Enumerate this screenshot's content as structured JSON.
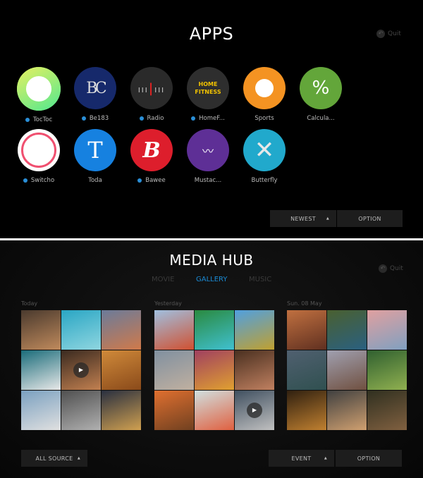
{
  "apps": {
    "title": "APPS",
    "quit": "Quit",
    "items": [
      {
        "label": "TocToc",
        "checked": true,
        "icon": "speech-bubble-icon",
        "color": "#7ee06a"
      },
      {
        "label": "Be183",
        "checked": true,
        "icon": "bc-logo-icon",
        "color": "#16296b"
      },
      {
        "label": "Radio",
        "checked": true,
        "icon": "radio-tuner-icon",
        "color": "#2a2a2a"
      },
      {
        "label": "HomeF...",
        "checked": true,
        "icon": "home-fitness-icon",
        "color": "#2e2e2e",
        "icon_text": "HOME FITNESS"
      },
      {
        "label": "Sports",
        "checked": false,
        "icon": "baseball-icon",
        "color": "#f49322"
      },
      {
        "label": "Calcula...",
        "checked": false,
        "icon": "percent-icon",
        "color": "#63a63a"
      },
      {
        "label": "Switcho",
        "checked": true,
        "icon": "power-dial-icon",
        "color": "#ffffff"
      },
      {
        "label": "Toda",
        "checked": false,
        "icon": "letter-t-icon",
        "color": "#1681e0",
        "icon_text": "T"
      },
      {
        "label": "Bawee",
        "checked": true,
        "icon": "letter-b-icon",
        "color": "#dd1e2c",
        "icon_text": "B"
      },
      {
        "label": "Mustac...",
        "checked": false,
        "icon": "mustache-wave-icon",
        "color": "#5e2f96"
      },
      {
        "label": "Butterfly",
        "checked": false,
        "icon": "butterfly-x-icon",
        "color": "#21a9cc"
      }
    ],
    "sort_button": "NEWEST",
    "option_button": "OPTION"
  },
  "media": {
    "title": "MEDIA HUB",
    "quit": "Quit",
    "tabs": [
      {
        "label": "MOVIE",
        "active": false
      },
      {
        "label": "GALLERY",
        "active": true
      },
      {
        "label": "MUSIC",
        "active": false
      }
    ],
    "groups": [
      {
        "label": "Today",
        "tiles": [
          [
            "#4a3a2e",
            "#c08a5c",
            false
          ],
          [
            "#2aa6c4",
            "#8fd6e0",
            false
          ],
          [
            "#6b7b9a",
            "#d07a4a",
            false
          ],
          [
            "#1a6c7a",
            "#e8e8e8",
            false
          ],
          [
            "#3a2a20",
            "#c28050",
            true
          ],
          [
            "#d08a3a",
            "#8a4a1a",
            false
          ],
          [
            "#7aa0c0",
            "#e0e0e0",
            false
          ],
          [
            "#505050",
            "#b0b0b0",
            false
          ],
          [
            "#2a3040",
            "#d0a050",
            false
          ]
        ]
      },
      {
        "label": "Yesterday",
        "tiles": [
          [
            "#a0c0e0",
            "#d05030",
            false
          ],
          [
            "#2a8a40",
            "#40c0d0",
            false
          ],
          [
            "#50a0e0",
            "#c0a030",
            false
          ],
          [
            "#8090a0",
            "#c0b0a0",
            false
          ],
          [
            "#a04060",
            "#e0a030",
            false
          ],
          [
            "#4a3020",
            "#c08060",
            false
          ],
          [
            "#e07030",
            "#704020",
            false
          ],
          [
            "#d0e0e0",
            "#e06040",
            false
          ],
          [
            "#405060",
            "#c0c0c0",
            true
          ]
        ]
      },
      {
        "label": "Sun. 08 May",
        "tiles": [
          [
            "#c07040",
            "#603020",
            false
          ],
          [
            "#4a6030",
            "#2a6080",
            false
          ],
          [
            "#e0a0a0",
            "#80a0c0",
            false
          ],
          [
            "#506070",
            "#305050",
            false
          ],
          [
            "#a0a0b0",
            "#705040",
            false
          ],
          [
            "#306030",
            "#90b050",
            false
          ],
          [
            "#302010",
            "#c08030",
            false
          ],
          [
            "#404040",
            "#d0a070",
            false
          ],
          [
            "#303020",
            "#806040",
            false
          ]
        ]
      }
    ],
    "source_button": "ALL SOURCE",
    "event_button": "EVENT",
    "option_button": "OPTION"
  }
}
